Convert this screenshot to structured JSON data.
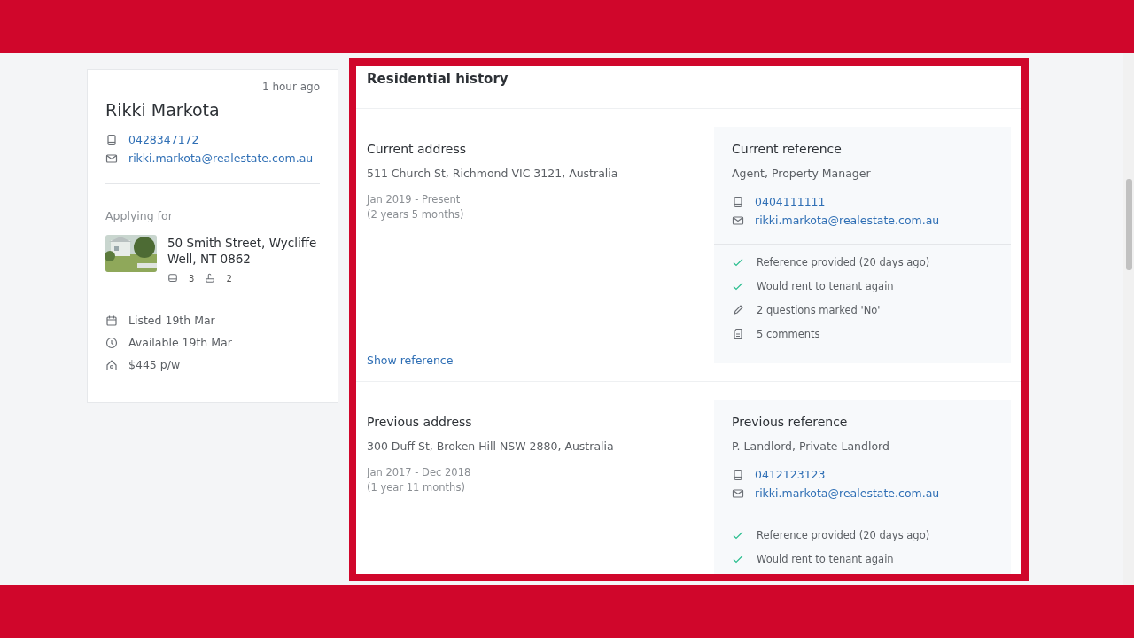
{
  "applicant": {
    "time": "1 hour ago",
    "name": "Rikki Markota",
    "phone": "0428347172",
    "email": "rikki.markota@realestate.com.au",
    "applying_label": "Applying for",
    "property": {
      "address": "50 Smith Street, Wycliffe Well, NT 0862",
      "beds": "3",
      "baths": "2"
    },
    "facts": [
      {
        "kind": "calendar",
        "text": "Listed 19th Mar"
      },
      {
        "kind": "clock",
        "text": "Available 19th Mar"
      },
      {
        "kind": "price",
        "text": "$445 p/w"
      }
    ]
  },
  "residential_history": {
    "title": "Residential history",
    "entries": [
      {
        "address_title": "Current address",
        "address": "511 Church St, Richmond VIC 3121, Australia",
        "period": "Jan 2019 - Present",
        "duration": "(2 years 5 months)",
        "link": "Show reference",
        "reference": {
          "title": "Current reference",
          "who": "Agent, Property Manager",
          "phone": "0404111111",
          "email": "rikki.markota@realestate.com.au",
          "items": [
            {
              "kind": "check",
              "text": "Reference provided (20 days ago)"
            },
            {
              "kind": "check",
              "text": "Would rent to tenant again"
            },
            {
              "kind": "pencil",
              "text": "2 questions marked 'No'"
            },
            {
              "kind": "note",
              "text": "5 comments"
            }
          ]
        }
      },
      {
        "address_title": "Previous address",
        "address": "300 Duff St, Broken Hill NSW 2880, Australia",
        "period": "Jan 2017 - Dec 2018",
        "duration": "(1 year 11 months)",
        "reference": {
          "title": "Previous reference",
          "who": "P. Landlord, Private Landlord",
          "phone": "0412123123",
          "email": "rikki.markota@realestate.com.au",
          "items": [
            {
              "kind": "check",
              "text": "Reference provided (20 days ago)"
            },
            {
              "kind": "check",
              "text": "Would rent to tenant again"
            }
          ]
        }
      }
    ]
  }
}
